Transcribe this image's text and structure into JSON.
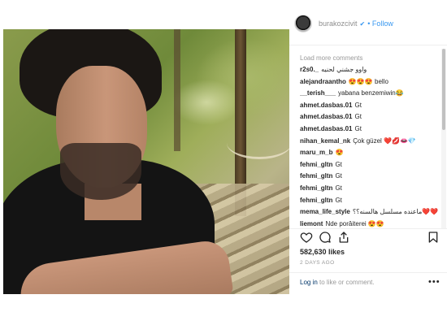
{
  "header": {
    "username": "burakozcivit",
    "verified_icon": "verified-badge-icon",
    "follow_label": "• Follow"
  },
  "comments": {
    "load_more": "Load more comments",
    "items": [
      {
        "user": "r2s0._",
        "text": "واوو جشني لحنيه"
      },
      {
        "user": "alejandraantho",
        "text": "😍😍😍 bello"
      },
      {
        "user": "__terish___",
        "text": "yabana benzemiwin😂"
      },
      {
        "user": "ahmet.dasbas.01",
        "text": "Gt"
      },
      {
        "user": "ahmet.dasbas.01",
        "text": "Gt"
      },
      {
        "user": "ahmet.dasbas.01",
        "text": "Gt"
      },
      {
        "user": "nihan_kemal_nk",
        "text": "Çok güzel ❤️💋👄💎"
      },
      {
        "user": "maru_m_b",
        "text": "😍"
      },
      {
        "user": "fehmi_gltn",
        "text": "Gt"
      },
      {
        "user": "fehmi_gltn",
        "text": "Gt"
      },
      {
        "user": "fehmi_gltn",
        "text": "Gt"
      },
      {
        "user": "fehmi_gltn",
        "text": "Gt"
      },
      {
        "user": "mema_life_style",
        "text": "ماعنده مسلسل هالسنه؟؟❤️❤️"
      },
      {
        "user": "liemont",
        "text": "Nde porâiterei 😍😍"
      }
    ]
  },
  "actions": {
    "like_icon": "heart-icon",
    "comment_icon": "comment-icon",
    "share_icon": "share-icon",
    "save_icon": "bookmark-icon"
  },
  "likes": "582,630 likes",
  "timestamp": "2 DAYS AGO",
  "login": {
    "link": "Log in",
    "suffix": " to like or comment."
  },
  "more_options": "•••"
}
